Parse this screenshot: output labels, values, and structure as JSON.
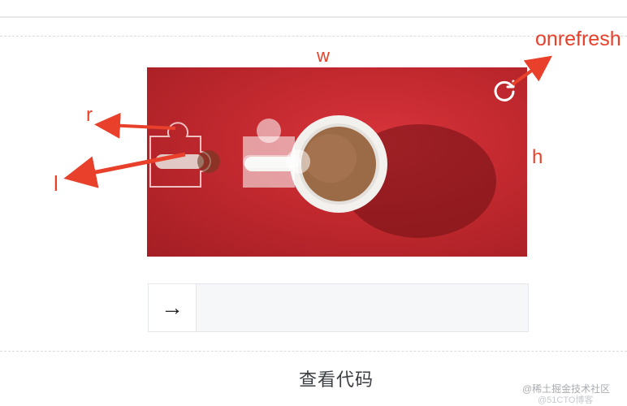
{
  "annotations": {
    "onrefresh": "onrefresh",
    "w": "w",
    "r": "r",
    "h": "h",
    "l": "l"
  },
  "captcha": {
    "background_color": "#c42a30",
    "refresh_icon": "refresh-icon"
  },
  "slider": {
    "handle_label": "→",
    "track_color": "#f5f7f9"
  },
  "footer": {
    "view_code_label": "查看代码",
    "watermark": "@稀土掘金技术社区",
    "watermark_sub": "@51CTO博客"
  },
  "colors": {
    "annotation": "#e8402a"
  }
}
